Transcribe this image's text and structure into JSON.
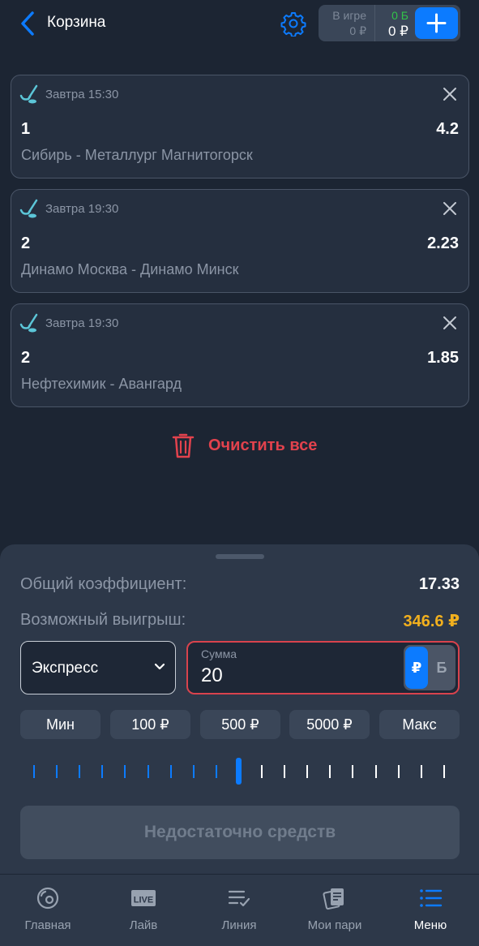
{
  "header": {
    "title": "Корзина",
    "balance": {
      "in_game_label": "В игре",
      "in_game_value": "0 ₽",
      "bonus_value": "0 Б",
      "money_value": "0 ₽"
    }
  },
  "bets": [
    {
      "sport_icon": "hockey-icon",
      "time": "Завтра 15:30",
      "outcome": "1",
      "odds": "4.2",
      "match": "Сибирь - Металлург Магнитогорск"
    },
    {
      "sport_icon": "hockey-icon",
      "time": "Завтра 19:30",
      "outcome": "2",
      "odds": "2.23",
      "match": "Динамо Москва - Динамо Минск"
    },
    {
      "sport_icon": "hockey-icon",
      "time": "Завтра 19:30",
      "outcome": "2",
      "odds": "1.85",
      "match": "Нефтехимик - Авангард"
    }
  ],
  "clear_all_label": "Очистить все",
  "summary": {
    "total_odds_label": "Общий коэффициент:",
    "total_odds_value": "17.33",
    "possible_win_label": "Возможный выигрыш:",
    "possible_win_value": "346.6 ₽"
  },
  "bet_type": {
    "selected": "Экспресс"
  },
  "stake": {
    "label": "Сумма",
    "value": "20",
    "currency_rub": "₽",
    "currency_bonus": "Б"
  },
  "quick_amounts": [
    "Мин",
    "100 ₽",
    "500 ₽",
    "5000 ₽",
    "Макс"
  ],
  "slider": {
    "ticks": 19,
    "active_index": 9
  },
  "submit_label": "Недостаточно средств",
  "tabs": [
    {
      "label": "Главная",
      "icon": "home-icon"
    },
    {
      "label": "Лайв",
      "icon": "live-icon"
    },
    {
      "label": "Линия",
      "icon": "line-icon"
    },
    {
      "label": "Мои пари",
      "icon": "my-bets-icon"
    },
    {
      "label": "Меню",
      "icon": "menu-icon",
      "active": true
    }
  ],
  "colors": {
    "background": "#1c2533",
    "accent": "#0c7bff",
    "danger": "#e2424d",
    "win": "#f2b01e",
    "bonus": "#33c24a"
  }
}
